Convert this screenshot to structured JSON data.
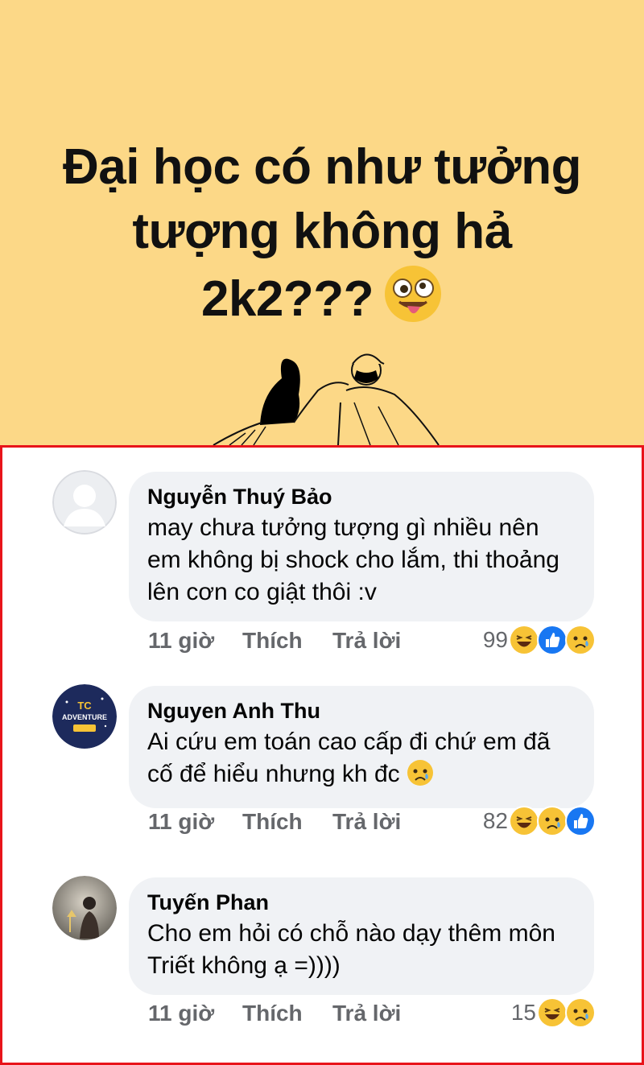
{
  "banner": {
    "lines": [
      "Đại học có như tưởng",
      "tượng không hả",
      "2k2???"
    ],
    "emoji": "zany-face-icon"
  },
  "comments": [
    {
      "author": "Nguyễn Thuý Bảo",
      "text": "may chưa tưởng tượng gì nhiều nên em không bị shock cho lắm, thi thoảng lên cơn co giật thôi :v",
      "time": "11 giờ",
      "like": "Thích",
      "reply": "Trả lời",
      "reaction_count": "99",
      "reactions": [
        "haha-icon",
        "like-icon",
        "sad-icon"
      ]
    },
    {
      "author": "Nguyen Anh Thu",
      "text": "Ai cứu em toán cao cấp đi chứ em đã cố để hiểu nhưng kh đc",
      "avatar_text": [
        "TC",
        "ADVENTURE"
      ],
      "time": "11 giờ",
      "like": "Thích",
      "reply": "Trả lời",
      "reaction_count": "82",
      "reactions": [
        "haha-icon",
        "sad-icon",
        "like-icon"
      ]
    },
    {
      "author": "Tuyến Phan",
      "text": "Cho em hỏi có chỗ nào dạy thêm môn Triết không ạ =))))",
      "time": "11 giờ",
      "like": "Thích",
      "reply": "Trả lời",
      "reaction_count": "15",
      "reactions": [
        "haha-icon",
        "sad-icon"
      ]
    }
  ],
  "colors": {
    "banner_bg": "#fcd887",
    "frame_border": "#e8141a",
    "bubble_bg": "#f0f2f5",
    "like_blue": "#1877f2",
    "emoji_yellow": "#f7c336"
  }
}
